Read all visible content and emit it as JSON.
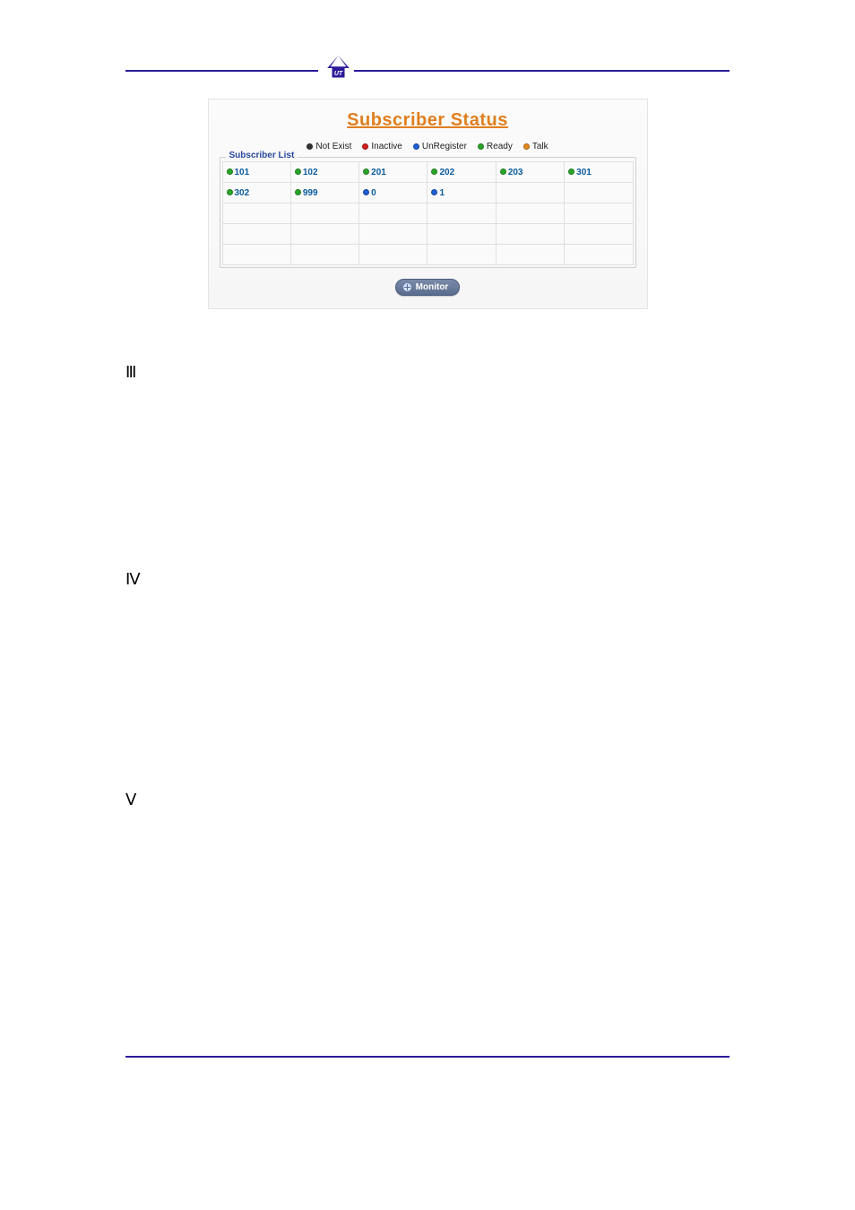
{
  "shot": {
    "title": "Subscriber Status",
    "fieldset_label": "Subscriber List",
    "legend": [
      {
        "color": "c-black",
        "label": "Not Exist"
      },
      {
        "color": "c-red",
        "label": "Inactive"
      },
      {
        "color": "c-blue",
        "label": "UnRegister"
      },
      {
        "color": "c-green",
        "label": "Ready"
      },
      {
        "color": "c-orange",
        "label": "Talk"
      }
    ],
    "grid": [
      [
        {
          "color": "c-green",
          "num": "101"
        },
        {
          "color": "c-green",
          "num": "102"
        },
        {
          "color": "c-green",
          "num": "201"
        },
        {
          "color": "c-green",
          "num": "202"
        },
        {
          "color": "c-green",
          "num": "203"
        },
        {
          "color": "c-green",
          "num": "301"
        }
      ],
      [
        {
          "color": "c-green",
          "num": "302"
        },
        {
          "color": "c-green",
          "num": "999"
        },
        {
          "color": "c-blue",
          "num": "0"
        },
        {
          "color": "c-blue",
          "num": "1"
        },
        null,
        null
      ],
      [
        null,
        null,
        null,
        null,
        null,
        null
      ],
      [
        null,
        null,
        null,
        null,
        null,
        null
      ],
      [
        null,
        null,
        null,
        null,
        null,
        null
      ]
    ],
    "monitor_label": "Monitor"
  },
  "sections": {
    "iii": "Ⅲ",
    "iv": "Ⅳ",
    "v": "Ⅴ"
  }
}
